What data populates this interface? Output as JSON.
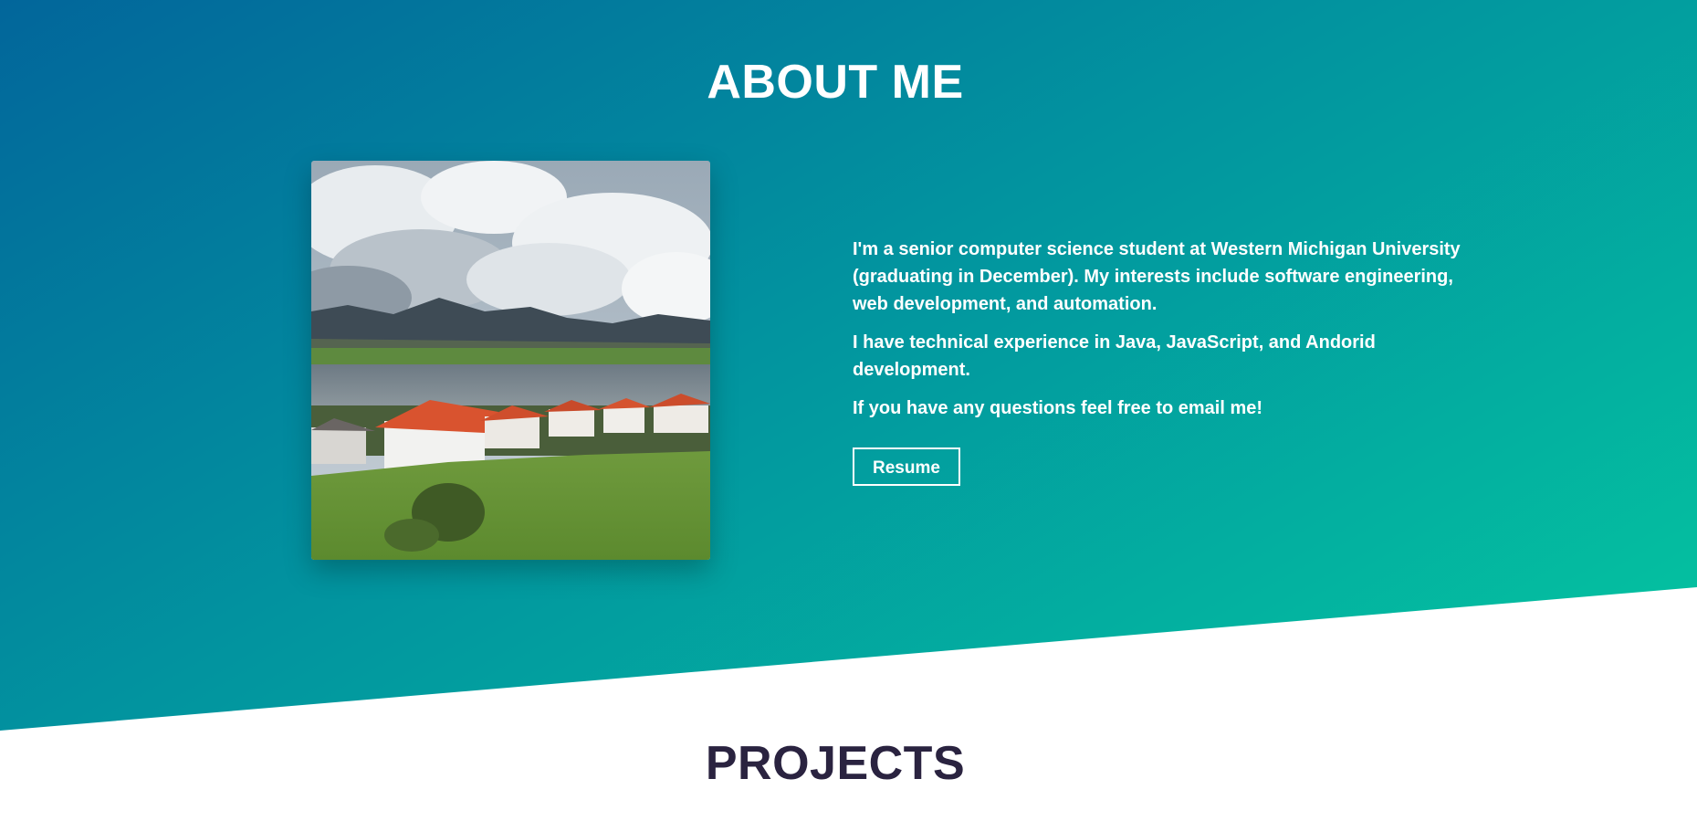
{
  "about": {
    "title": "ABOUT ME",
    "paragraphs": [
      "I'm a senior computer science student at Western Michigan University (graduating in December). My interests include software engineering, web development, and automation.",
      "I have technical experience in Java, JavaScript, and Andorid development.",
      "If you have any questions feel free to email me!"
    ],
    "resume_label": "Resume",
    "photo_icon": "landscape-photo"
  },
  "projects": {
    "title": "PROJECTS"
  },
  "colors": {
    "gradient_start": "#02669b",
    "gradient_mid": "#02939f",
    "gradient_end": "#04c7a0",
    "projects_title": "#2a2340",
    "text_light": "#ffffff"
  }
}
